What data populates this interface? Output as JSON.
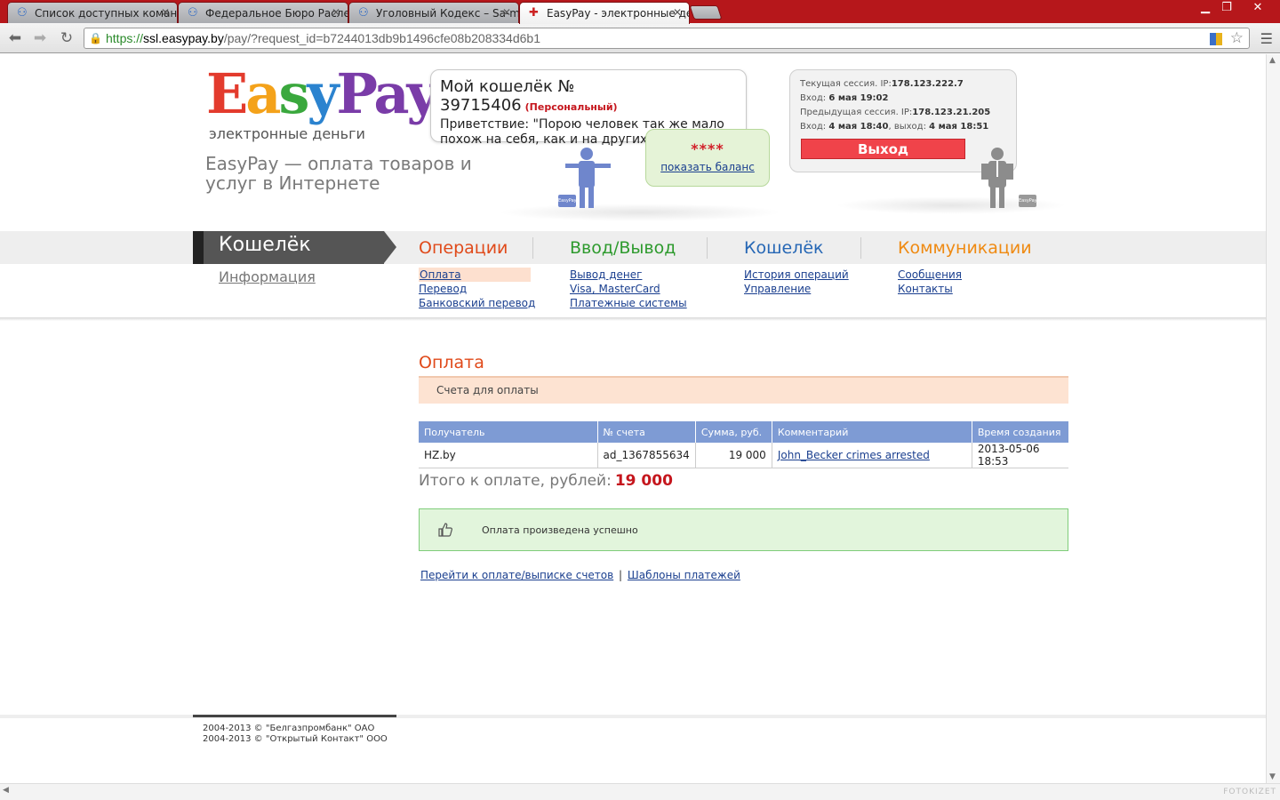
{
  "browser": {
    "tabs": [
      {
        "title": "Список доступных команд"
      },
      {
        "title": "Федеральное Бюро Расле"
      },
      {
        "title": "Уголовный Кодекс – Sa-mp"
      },
      {
        "title": "EasyPay - электронные ден"
      }
    ],
    "url": {
      "scheme": "https://",
      "host": "ssl.easypay.by",
      "path": "/pay/?request_id=b7244013db9b1496cfe08b208334d6b1"
    },
    "watermark": "FOTOKIZET"
  },
  "header": {
    "logo": {
      "e": "E",
      "a": "a",
      "s": "s",
      "y": "y",
      "pay": "Pay"
    },
    "logo_sub": "электронные деньги",
    "tagline": "EasyPay — оплата товаров и услуг в Интернете",
    "wallet_title": "Мой кошелёк № 39715406",
    "wallet_type": "(Персональный)",
    "greeting": "Приветствие: \"Порою человек так же мало похож на себя, как и на других.\"",
    "balance_mask": "****",
    "show_balance": "показать баланс",
    "bag_label": "EasyPay",
    "session": {
      "current_label": "Текущая сессия. IP:",
      "current_ip": "178.123.222.7",
      "login_label": "Вход:",
      "login_time": "6 мая 19:02",
      "prev_label": "Предыдущая сессия. IP:",
      "prev_ip": "178.123.21.205",
      "prev_login_label": "Вход:",
      "prev_login_time": "4 мая 18:40",
      "prev_exit_label": ", выход:",
      "prev_exit_time": "4 мая 18:51",
      "logout": "Выход"
    }
  },
  "nav": {
    "active_section": "Кошелёк",
    "active_sub": "Информация",
    "categories": [
      {
        "label": "Операции",
        "color": "#e04a1a",
        "links": [
          "Оплата",
          "Перевод",
          "Банковский перевод"
        ]
      },
      {
        "label": "Ввод/Вывод",
        "color": "#2d9a2d",
        "links": [
          "Вывод денег",
          "Visa, MasterCard",
          "Платежные системы"
        ]
      },
      {
        "label": "Кошелёк",
        "color": "#2667b5",
        "links": [
          "История операций",
          "Управление"
        ]
      },
      {
        "label": "Коммуникации",
        "color": "#ef8a12",
        "links": [
          "Сообщения",
          "Контакты"
        ]
      }
    ]
  },
  "content": {
    "title": "Оплата",
    "invoice_bar": "Счета для оплаты",
    "table": {
      "headers": [
        "Получатель",
        "№ счета",
        "Сумма, руб.",
        "Комментарий",
        "Время создания"
      ],
      "rows": [
        [
          "HZ.by",
          "ad_1367855634",
          "19 000",
          "John_Becker crimes arrested",
          "2013-05-06 18:53"
        ]
      ]
    },
    "total_label": "Итого к оплате, рублей:",
    "total_value": "19 000",
    "success": "Оплата произведена успешно",
    "link_pay": "Перейти к оплате/выписке счетов",
    "link_sep": "|",
    "link_templates": "Шаблоны платежей"
  },
  "footer": {
    "line1": "2004-2013 © \"Белгазпромбанк\" ОАО",
    "line2": "2004-2013 © \"Открытый Контакт\" ООО"
  }
}
